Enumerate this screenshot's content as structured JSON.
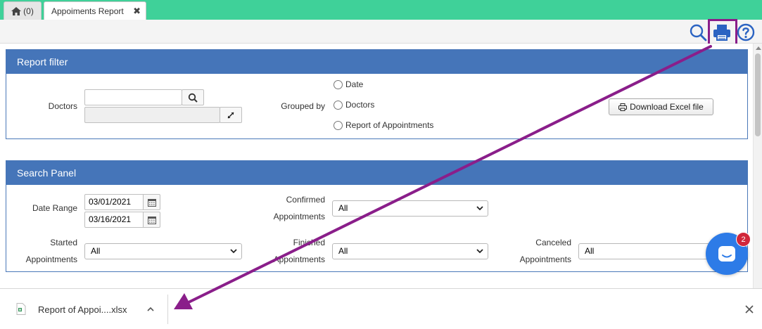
{
  "tabs": {
    "home_count": "(0)",
    "active_label": "Appoiments Report",
    "close_glyph": "✖"
  },
  "toolbar": {
    "icons": [
      "search-icon",
      "print-icon",
      "help-icon"
    ],
    "highlight_color": "#8a1e8a"
  },
  "report_filter": {
    "title": "Report filter",
    "doctors_label": "Doctors",
    "doctors_value": "",
    "grouped_by_label": "Grouped by",
    "group_options": [
      "Date",
      "Doctors",
      "Report of Appointments"
    ],
    "download_label": "Download Excel file"
  },
  "search_panel": {
    "title": "Search Panel",
    "date_range_label": "Date Range",
    "date_from": "03/01/2021",
    "date_to": "03/16/2021",
    "confirmed_label_1": "Confirmed",
    "confirmed_label_2": "Appointments",
    "confirmed_value": "All",
    "started_label_1": "Started",
    "started_label_2": "Appointments",
    "started_value": "All",
    "finished_label_1": "Finished",
    "finished_label_2": "Appointments",
    "finished_value": "All",
    "canceled_label_1": "Canceled",
    "canceled_label_2": "Appointments",
    "canceled_value": "All"
  },
  "chat": {
    "badge": "2"
  },
  "download_bar": {
    "file_name": "Report of Appoi....xlsx"
  },
  "colors": {
    "tabbar": "#3fd199",
    "panel_header": "#4575b9",
    "chat": "#2d7be7",
    "badge": "#d1273b",
    "arrow": "#8a1e8a"
  }
}
